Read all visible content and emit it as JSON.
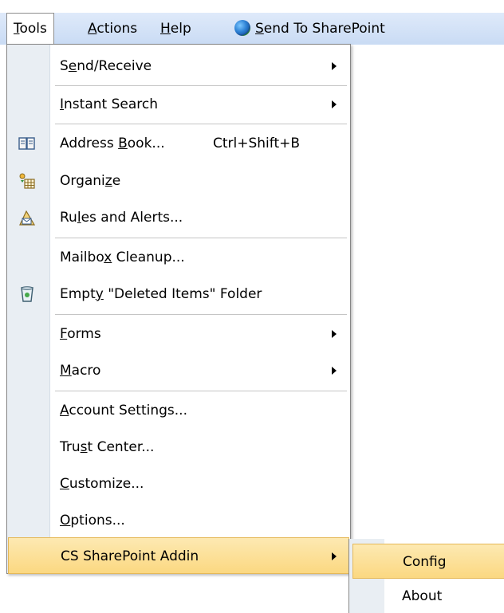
{
  "menubar": {
    "items": [
      {
        "pre": "",
        "acc": "T",
        "post": "ools"
      },
      {
        "pre": "",
        "acc": "A",
        "post": "ctions"
      },
      {
        "pre": "",
        "acc": "H",
        "post": "elp"
      },
      {
        "pre": "",
        "acc": "S",
        "post": "end To SharePoint"
      }
    ]
  },
  "menu": {
    "send_receive": {
      "pre": "S",
      "acc": "e",
      "post": "nd/Receive"
    },
    "instant_search": {
      "pre": "",
      "acc": "I",
      "post": "nstant Search"
    },
    "address_book": {
      "pre": "Address ",
      "acc": "B",
      "post": "ook...",
      "shortcut": "Ctrl+Shift+B"
    },
    "organize": {
      "pre": "Organi",
      "acc": "z",
      "post": "e"
    },
    "rules_alerts": {
      "pre": "Ru",
      "acc": "l",
      "post": "es and Alerts..."
    },
    "mailbox_cleanup": {
      "pre": "Mailbo",
      "acc": "x",
      "post": " Cleanup..."
    },
    "empty_deleted": {
      "pre": "Empt",
      "acc": "y",
      "post": " \"Deleted Items\" Folder"
    },
    "forms": {
      "pre": "",
      "acc": "F",
      "post": "orms"
    },
    "macro": {
      "pre": "",
      "acc": "M",
      "post": "acro"
    },
    "account_settings": {
      "pre": "",
      "acc": "A",
      "post": "ccount Settings..."
    },
    "trust_center": {
      "pre": "Tru",
      "acc": "s",
      "post": "t Center..."
    },
    "customize": {
      "pre": "",
      "acc": "C",
      "post": "ustomize..."
    },
    "options": {
      "pre": "",
      "acc": "O",
      "post": "ptions..."
    },
    "cs_addin": {
      "label": "CS SharePoint Addin"
    }
  },
  "submenu": {
    "config": "Config",
    "about": "About"
  },
  "colors": {
    "menubar_bg": "#c9dbf4",
    "highlight": "#fbd881",
    "gutter": "#e9eef3"
  }
}
